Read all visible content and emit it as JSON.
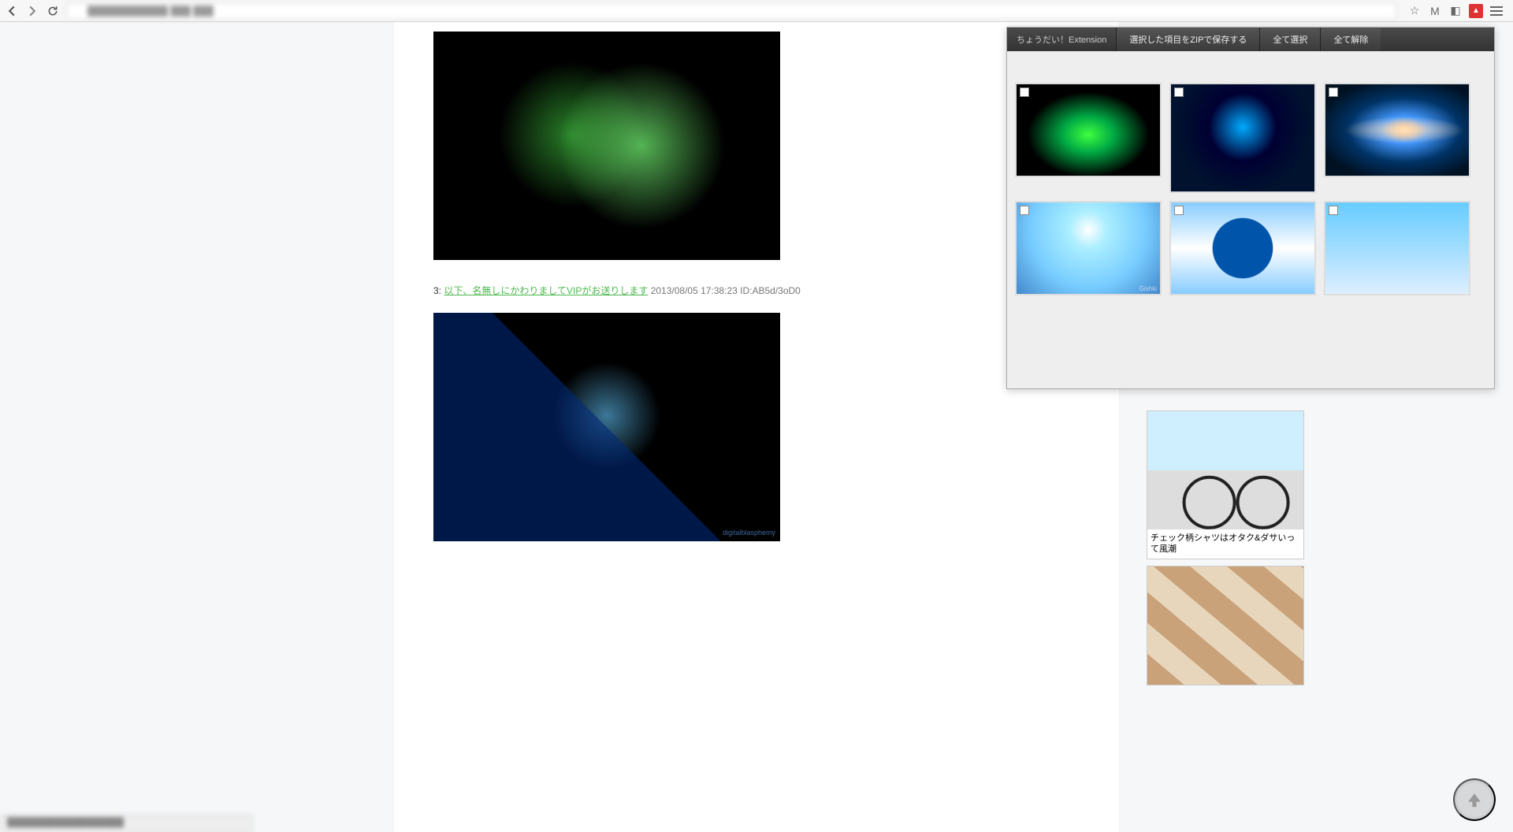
{
  "browser": {
    "url_display": "████████████ ███ ███",
    "star_tooltip": "Bookmark",
    "icons": [
      "star",
      "gmail",
      "ext-a",
      "ext-b"
    ]
  },
  "extension": {
    "title": "ちょうだい！Extension",
    "btn_save": "選択した項目をZIPで保存する",
    "btn_select_all": "全て選択",
    "btn_deselect_all": "全て解除",
    "thumbs": [
      {
        "id": "green",
        "checked": false
      },
      {
        "id": "bluecubes",
        "checked": false,
        "big": true
      },
      {
        "id": "galaxy",
        "checked": false
      },
      {
        "id": "sky1",
        "checked": false,
        "caption": "Gishki"
      },
      {
        "id": "sky2",
        "checked": false
      },
      {
        "id": "sky3",
        "checked": false
      }
    ]
  },
  "post": {
    "num": "3:",
    "name": "以下、名無しにかわりましてVIPがお送りします",
    "timestamp": "2013/08/05 17:38:23",
    "uid": "ID:AB5d/3oD0",
    "watermark": "digitalblasphemy"
  },
  "sidebar": {
    "card1_caption": "チェック柄シャツはオタク&ダサいって風潮"
  },
  "scroll_top_aria": "Scroll to top",
  "status_text": "███████████████████"
}
